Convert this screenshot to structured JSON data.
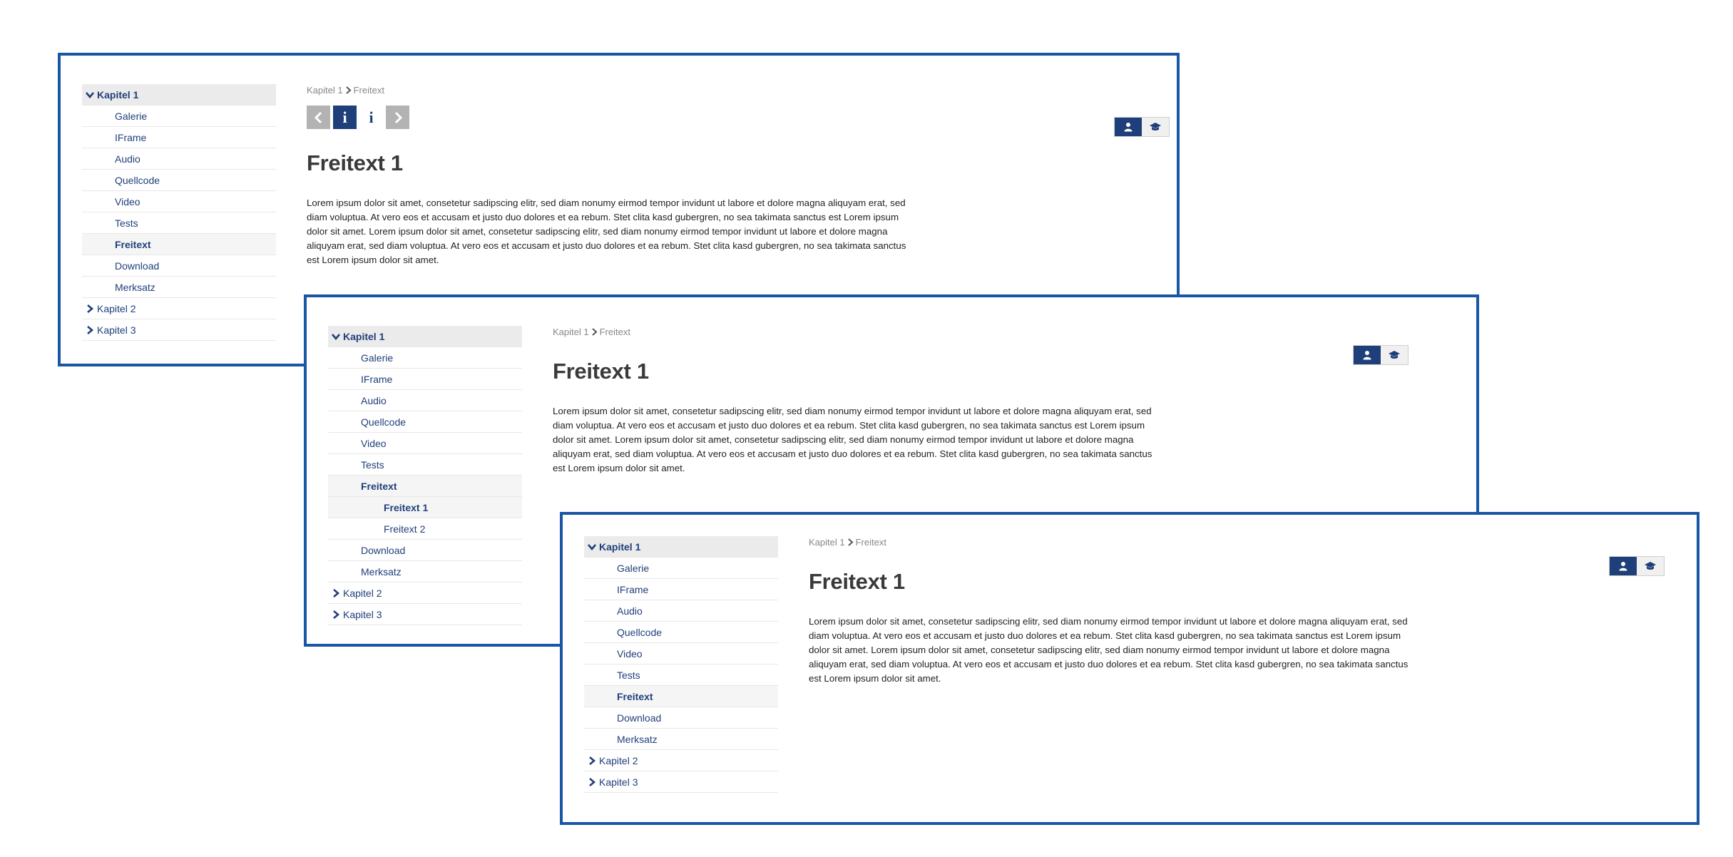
{
  "breadcrumb": {
    "root": "Kapitel 1",
    "current": "Freitext"
  },
  "page": {
    "title": "Freitext 1",
    "body": "Lorem ipsum dolor sit amet, consetetur sadipscing elitr, sed diam nonumy eirmod tempor invidunt ut labore et dolore magna aliquyam erat, sed diam voluptua. At vero eos et accusam et justo duo dolores et ea rebum. Stet clita kasd gubergren, no sea takimata sanctus est Lorem ipsum dolor sit amet. Lorem ipsum dolor sit amet, consetetur sadipscing elitr, sed diam nonumy eirmod tempor invidunt ut labore et dolore magna aliquyam erat, sed diam voluptua. At vero eos et accusam et justo duo dolores et ea rebum. Stet clita kasd gubergren, no sea takimata sanctus est Lorem ipsum dolor sit amet."
  },
  "nav": {
    "kapitel1": "Kapitel 1",
    "kapitel2": "Kapitel 2",
    "kapitel3": "Kapitel 3",
    "items": [
      "Galerie",
      "IFrame",
      "Audio",
      "Quellcode",
      "Video",
      "Tests",
      "Freitext",
      "Download",
      "Merksatz"
    ],
    "freitext_children": [
      "Freitext 1",
      "Freitext 2"
    ]
  },
  "page_nav": {
    "info_label": "i"
  },
  "role_switch": {
    "icons": [
      "user-icon",
      "graduation-cap-icon"
    ],
    "active": "user-icon"
  },
  "colors": {
    "frame_border": "#1a56a6",
    "primary": "#1f3f7a",
    "muted_button": "#b3b3b3"
  }
}
